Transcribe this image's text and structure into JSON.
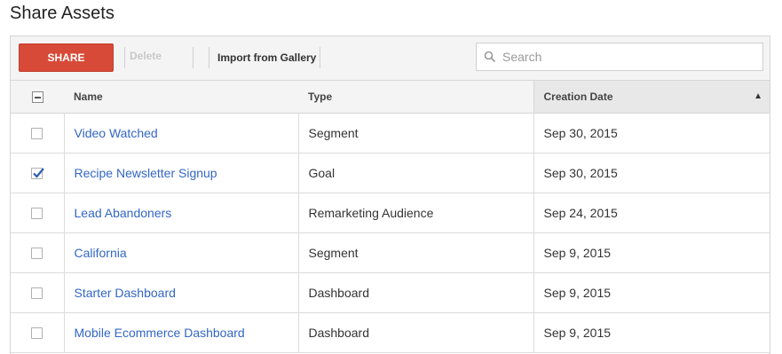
{
  "page": {
    "title": "Share Assets"
  },
  "toolbar": {
    "share_label": "SHARE",
    "delete_label": "Delete",
    "import_label": "Import from Gallery",
    "search_placeholder": "Search",
    "search_value": "",
    "share_color": "#d74a38"
  },
  "table": {
    "columns": {
      "name": "Name",
      "type": "Type",
      "date": "Creation Date"
    },
    "sort": {
      "column": "Creation Date",
      "direction": "up-arrow"
    },
    "header_checkbox": "indeterminate",
    "link_color": "#3367c4",
    "rows": [
      {
        "name": "Video Watched",
        "type": "Segment",
        "date": "Sep 30, 2015",
        "checked": false
      },
      {
        "name": "Recipe Newsletter Signup",
        "type": "Goal",
        "date": "Sep 30, 2015",
        "checked": true
      },
      {
        "name": "Lead Abandoners",
        "type": "Remarketing Audience",
        "date": "Sep 24, 2015",
        "checked": false
      },
      {
        "name": "California",
        "type": "Segment",
        "date": "Sep 9, 2015",
        "checked": false
      },
      {
        "name": "Starter Dashboard",
        "type": "Dashboard",
        "date": "Sep 9, 2015",
        "checked": false
      },
      {
        "name": "Mobile Ecommerce Dashboard",
        "type": "Dashboard",
        "date": "Sep 9, 2015",
        "checked": false
      }
    ]
  }
}
